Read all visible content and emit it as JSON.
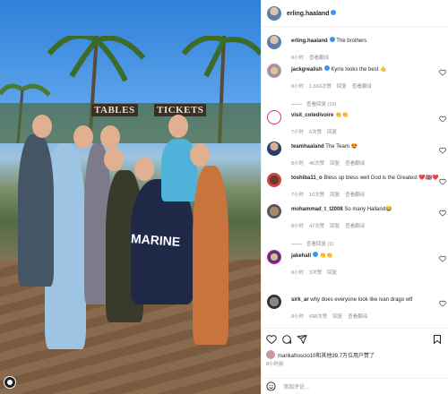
{
  "photo": {
    "sign_left": "TABLES",
    "sign_right": "TICKETS",
    "shirt_text": "MARINE"
  },
  "post": {
    "author": "erling.haaland",
    "header_username": "erling.haaland"
  },
  "caption": {
    "username": "erling.haaland",
    "text": "The brothers",
    "time": "8小时",
    "translate": "查看翻译"
  },
  "comments": [
    {
      "username": "jackgrealish",
      "text": "Kyrre looks the best 🤙",
      "time": "8小时",
      "likes": "1,663次赞",
      "reply": "回复",
      "translate": "查看翻译",
      "replies": "查看回复 (19)"
    },
    {
      "username": "visit_cotedivoire",
      "text": "👏👏",
      "time": "7小时",
      "likes": "6次赞",
      "reply": "回复"
    },
    {
      "username": "teamhaaland",
      "text": "The Team 😍",
      "time": "8小时",
      "likes": "46次赞",
      "reply": "回复",
      "translate": "查看翻译"
    },
    {
      "username": "toshiba11_o",
      "text": "Bless up bless well God is the Greatest ❤️🇬🇧❤️",
      "time": "7小时",
      "likes": "10次赞",
      "reply": "回复",
      "translate": "查看翻译"
    },
    {
      "username": "mohammad_t_t2008",
      "text": "So many Halland😂",
      "time": "8小时",
      "likes": "47次赞",
      "reply": "回复",
      "translate": "查看翻译",
      "replies": "查看回复 (1)"
    },
    {
      "username": "jakehall",
      "text": "👏👏",
      "time": "8小时",
      "likes": "3次赞",
      "reply": "回复"
    },
    {
      "username": "sirk_ar",
      "text": "why does everyone look like ivan drago wtf",
      "time": "8小时",
      "likes": "698次赞",
      "reply": "回复",
      "translate": "查看翻译"
    }
  ],
  "actions": {
    "likes_text": "marikafruscio10和其他39.7万位用户赞了",
    "time": "8小时前"
  },
  "comment_input": {
    "placeholder": "添加评论..."
  },
  "colors": {
    "verified": "#3897f0",
    "meta_gray": "#8e8e8e",
    "border": "#efefef"
  }
}
